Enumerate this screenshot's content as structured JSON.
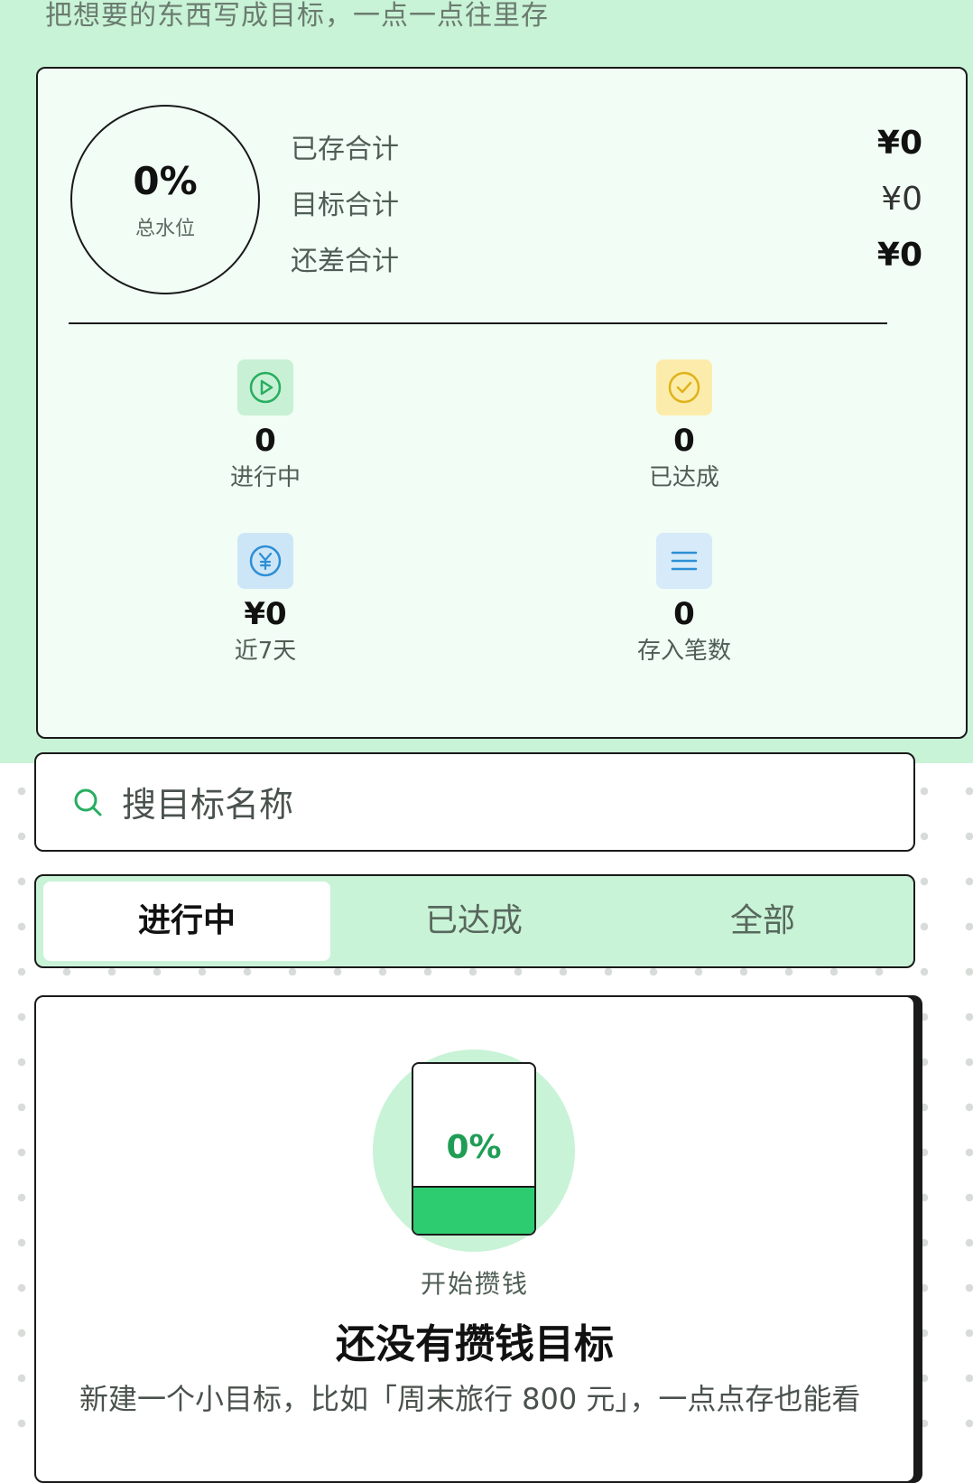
{
  "header": {
    "subtitle": "把想要的东西写成目标，一点一点往里存"
  },
  "overview": {
    "progress_percent": "0%",
    "progress_label": "总水位",
    "saved_label": "已存合计",
    "saved_value": "¥0",
    "target_label": "目标合计",
    "target_value": "¥0",
    "remaining_label": "还差合计",
    "remaining_value": "¥0"
  },
  "stats": {
    "in_progress_count": "0",
    "in_progress_label": "进行中",
    "achieved_count": "0",
    "achieved_label": "已达成",
    "last7_amount": "¥0",
    "last7_label": "近7天",
    "deposit_count": "0",
    "deposit_label": "存入笔数"
  },
  "search": {
    "placeholder": "搜目标名称"
  },
  "tabs": [
    "进行中",
    "已达成",
    "全部"
  ],
  "empty_state": {
    "jar_percent": "0%",
    "caption": "开始攒钱",
    "title": "还没有攒钱目标",
    "description": "新建一个小目标，比如「周末旅行 800 元」，一点点存也能看"
  },
  "colors": {
    "brand_green": "#2ecc71",
    "mint_background": "#c8f3d6",
    "card_background": "#f1fdf5"
  }
}
